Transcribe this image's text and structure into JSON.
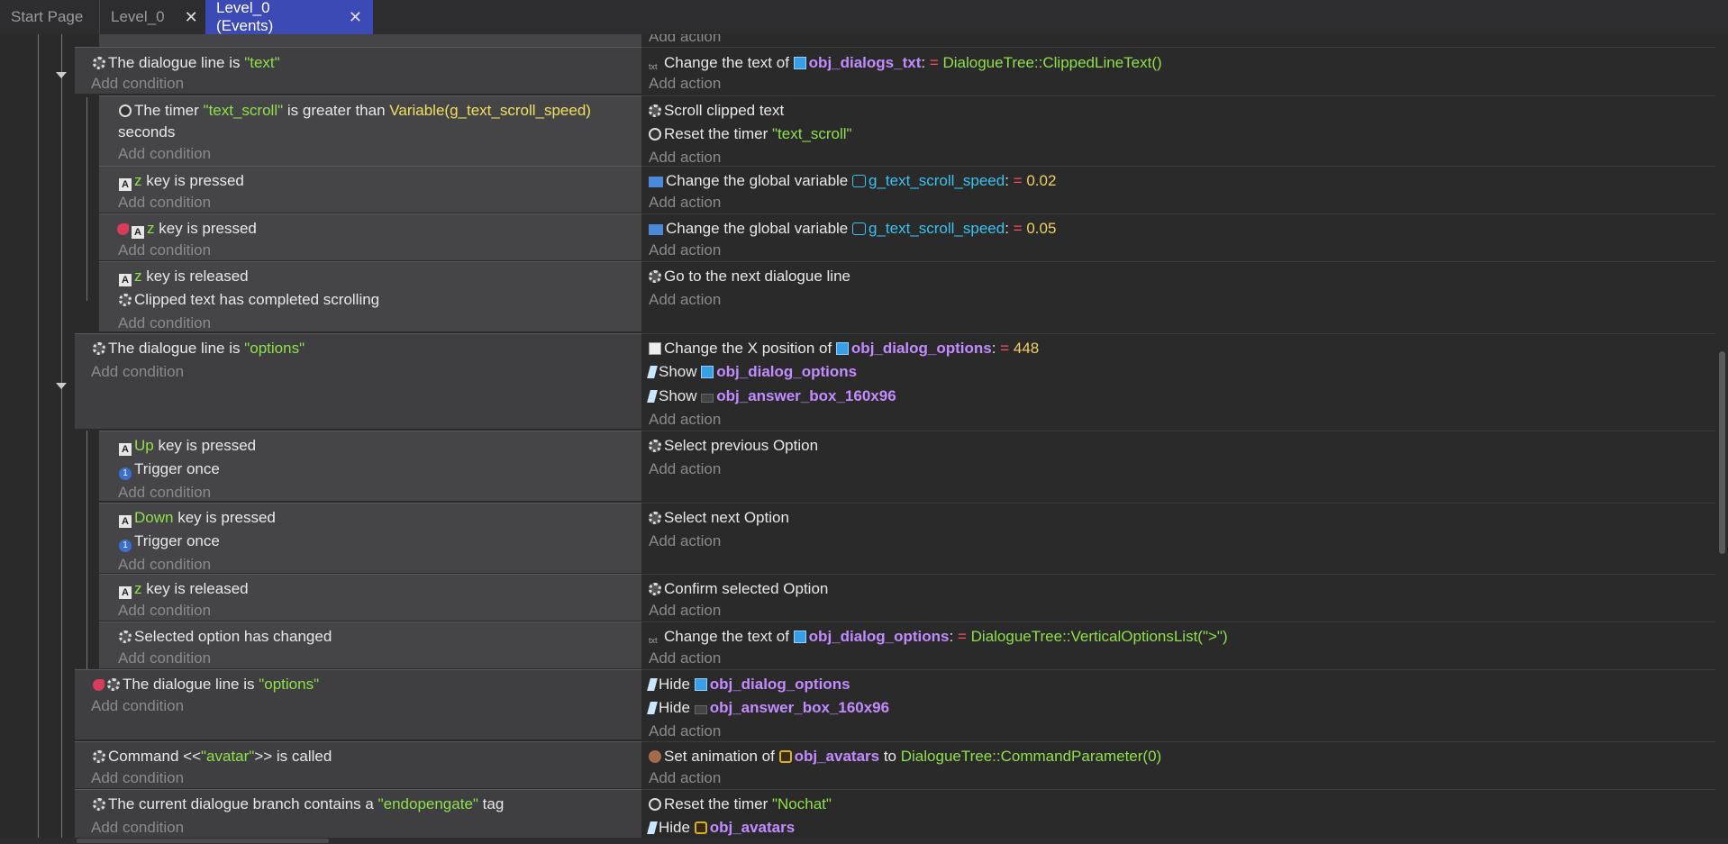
{
  "tabs": [
    {
      "label": "Start Page"
    },
    {
      "label": "Level_0",
      "close": "✕"
    },
    {
      "label": "Level_0 (Events)",
      "close": "✕"
    }
  ],
  "labels": {
    "add_condition": "Add condition",
    "add_action": "Add action"
  },
  "events": {
    "e0_cond": "The dialogue line is",
    "e0_str": "\"text\"",
    "e0_act_a": "Change the text of",
    "e0_act_obj": "obj_dialogs_txt",
    "e0_act_eq": "=",
    "e0_act_fn": "DialogueTree::ClippedLineText()",
    "e1_cond_a": "The timer",
    "e1_cond_str": "\"text_scroll\"",
    "e1_cond_b": "is greater than",
    "e1_cond_var": "Variable(g_text_scroll_speed)",
    "e1_cond_c": "seconds",
    "e1_act1": "Scroll clipped text",
    "e1_act2_a": "Reset the timer",
    "e1_act2_str": "\"text_scroll\"",
    "e2_key": "z",
    "e2_cond": "key is pressed",
    "e2_act_a": "Change the global variable",
    "e2_act_var": "g_text_scroll_speed",
    "e2_act_eq": "=",
    "e2_act_num": "0.02",
    "e3_key": "z",
    "e3_cond": "key is pressed",
    "e3_act_a": "Change the global variable",
    "e3_act_var": "g_text_scroll_speed",
    "e3_act_eq": "=",
    "e3_act_num": "0.05",
    "e4_key": "z",
    "e4_cond": "key is released",
    "e4_cond2": "Clipped text has completed scrolling",
    "e4_act": "Go to the next dialogue line",
    "e5_cond": "The dialogue line is",
    "e5_str": "\"options\"",
    "e5_act1_a": "Change the X position of",
    "e5_act1_obj": "obj_dialog_options",
    "e5_act1_eq": "=",
    "e5_act1_num": "448",
    "e5_act2_a": "Show",
    "e5_act2_obj": "obj_dialog_options",
    "e5_act3_a": "Show",
    "e5_act3_obj": "obj_answer_box_160x96",
    "e6_key": "Up",
    "e6_cond": "key is pressed",
    "e6_cond2": "Trigger once",
    "e6_act": "Select previous Option",
    "e7_key": "Down",
    "e7_cond": "key is pressed",
    "e7_cond2": "Trigger once",
    "e7_act": "Select next Option",
    "e8_key": "z",
    "e8_cond": "key is released",
    "e8_act": "Confirm selected Option",
    "e9_cond": "Selected option has changed",
    "e9_act_a": "Change the text of",
    "e9_act_obj": "obj_dialog_options",
    "e9_act_eq": "=",
    "e9_act_fn": "DialogueTree::VerticalOptionsList(\">\")",
    "e10_cond": "The dialogue line is",
    "e10_str": "\"options\"",
    "e10_act1_a": "Hide",
    "e10_act1_obj": "obj_dialog_options",
    "e10_act2_a": "Hide",
    "e10_act2_obj": "obj_answer_box_160x96",
    "e11_cond_a": "Command <<",
    "e11_cond_str": "\"avatar\"",
    "e11_cond_b": ">> is called",
    "e11_act_a": "Set animation of",
    "e11_act_obj": "obj_avatars",
    "e11_act_b": "to",
    "e11_act_fn": "DialogueTree::CommandParameter(0)",
    "e12_cond_a": "The current dialogue branch contains a",
    "e12_cond_str": "\"endopengate\"",
    "e12_cond_b": "tag",
    "e12_act1_a": "Reset the timer",
    "e12_act1_str": "\"Nochat\"",
    "e12_act2_a": "Hide",
    "e12_act2_obj": "obj_avatars"
  }
}
